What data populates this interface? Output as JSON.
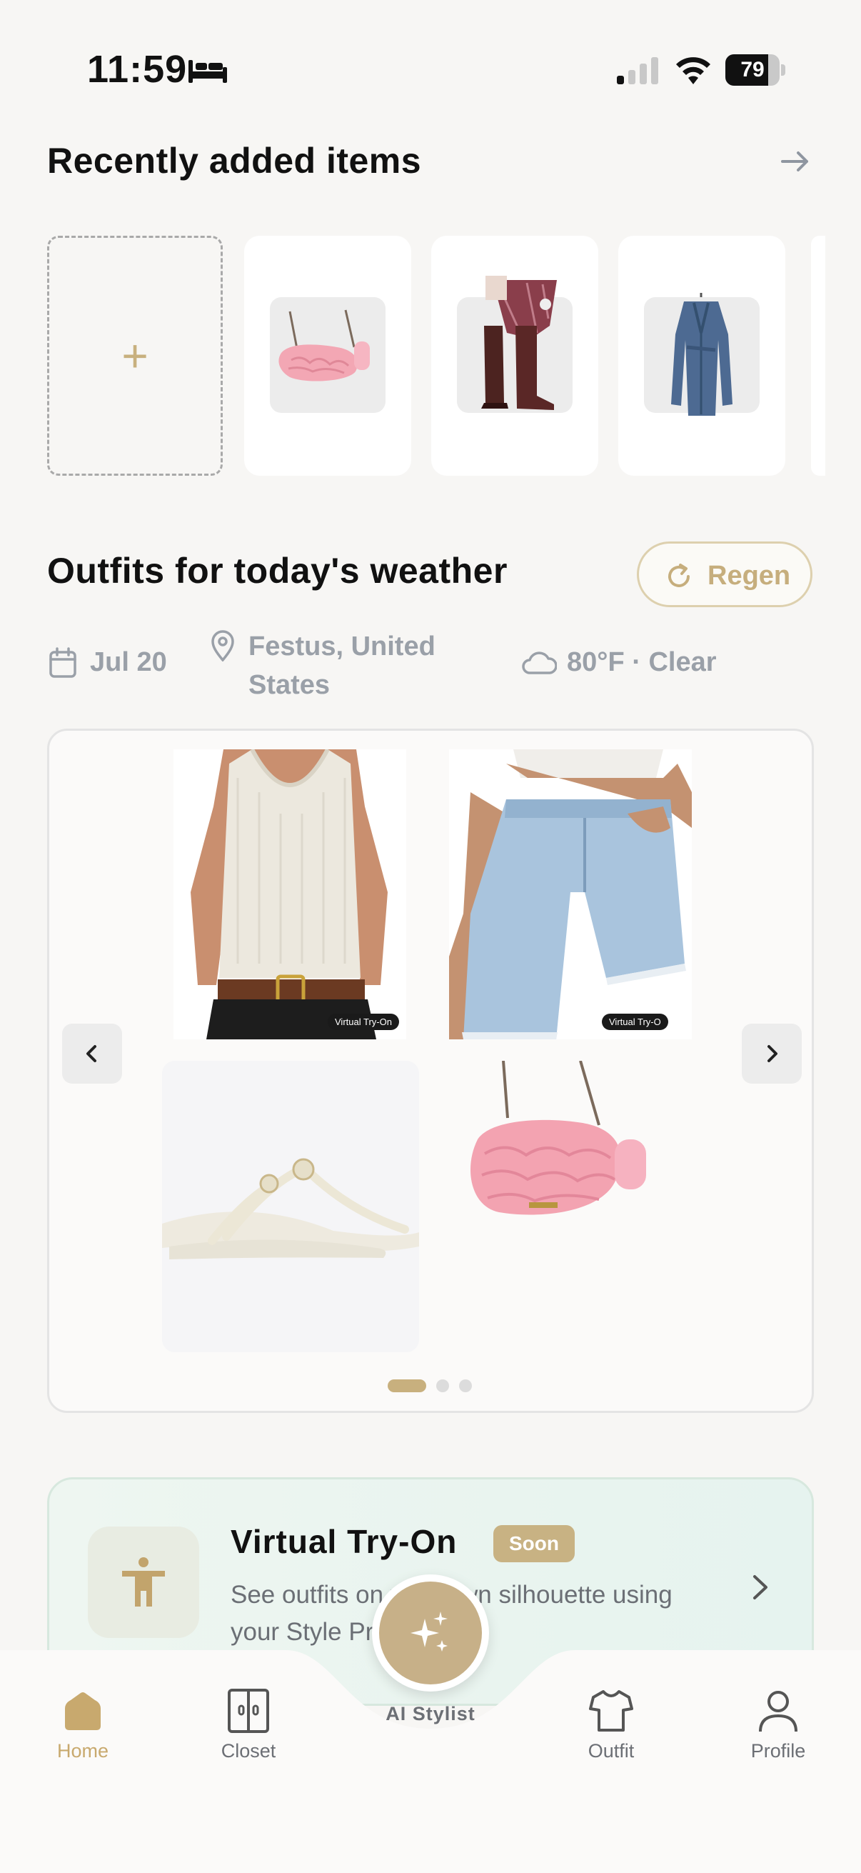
{
  "status_bar": {
    "time": "11:59",
    "battery": "79",
    "battery_level": 0.79,
    "icons": [
      "bed-icon",
      "cellular-signal-icon",
      "wifi-icon",
      "battery-icon"
    ]
  },
  "recent": {
    "title": "Recently added items",
    "add_label": "+",
    "items": [
      {
        "name": "pink quilted shoulder bag",
        "icon": "bag-thumbnail"
      },
      {
        "name": "burgundy dress with knee-high boots",
        "icon": "boots-thumbnail"
      },
      {
        "name": "denim trench coat",
        "icon": "coat-thumbnail"
      }
    ]
  },
  "outfits": {
    "title": "Outfits for today's weather",
    "regen_label": "Regen",
    "date": "Jul 20",
    "location": "Festus, United States",
    "location_line1": "Festus, United",
    "location_line2": "States",
    "weather": "80°F · Clear",
    "tag_label": "Virtual Try-On",
    "tag_label_cut": "Virtual Try-O",
    "items": [
      "cream knit tank top",
      "light denim shorts",
      "white thong sandals",
      "pink quilted shoulder bag"
    ],
    "page_index": 1,
    "page_count": 3
  },
  "virtual_tryon": {
    "title": "Virtual Try-On",
    "badge": "Soon",
    "line1": "See outfits on your own silhouette using",
    "line2": "your Style Profile"
  },
  "tabs": {
    "home": "Home",
    "closet": "Closet",
    "ai_stylist": "AI Stylist",
    "outfit": "Outfit",
    "profile": "Profile",
    "active": "home"
  },
  "colors": {
    "background": "#f7f6f4",
    "accent_gold": "#c8b07e",
    "muted_text": "#9aa0a8",
    "tryon_bg": "#eaf5f0",
    "badge_gold": "#c8b283"
  }
}
